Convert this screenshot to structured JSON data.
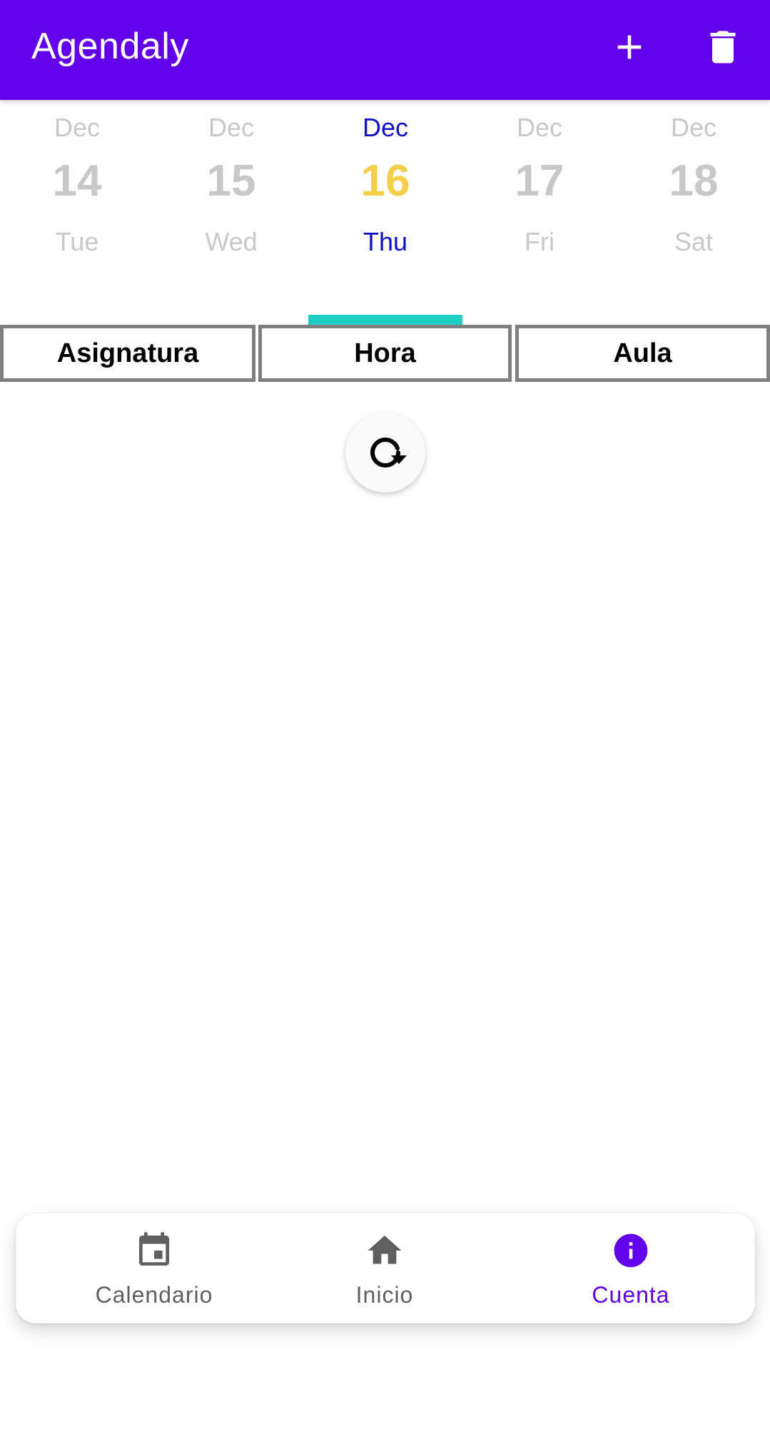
{
  "app": {
    "title": "Agendaly",
    "bar_color": "#6200ea"
  },
  "toolbar": {
    "add_icon": "plus-icon",
    "delete_icon": "trash-icon"
  },
  "days": [
    {
      "month": "Dec",
      "day": "14",
      "weekday": "Tue",
      "selected": false
    },
    {
      "month": "Dec",
      "day": "15",
      "weekday": "Wed",
      "selected": false
    },
    {
      "month": "Dec",
      "day": "16",
      "weekday": "Thu",
      "selected": true
    },
    {
      "month": "Dec",
      "day": "17",
      "weekday": "Fri",
      "selected": false
    },
    {
      "month": "Dec",
      "day": "18",
      "weekday": "Sat",
      "selected": false
    }
  ],
  "colors": {
    "selected_text": "#1010c8",
    "selected_day_number": "#f6cf4a",
    "indicator": "#1fcfc1",
    "inactive": "#c8c8c8"
  },
  "table": {
    "headers": [
      "Asignatura",
      "Hora",
      "Aula"
    ]
  },
  "refresh": {
    "icon": "refresh-icon"
  },
  "bottom_nav": {
    "items": [
      {
        "label": "Calendario",
        "icon": "calendar-icon",
        "active": false
      },
      {
        "label": "Inicio",
        "icon": "home-icon",
        "active": false
      },
      {
        "label": "Cuenta",
        "icon": "info-icon",
        "active": true
      }
    ]
  }
}
